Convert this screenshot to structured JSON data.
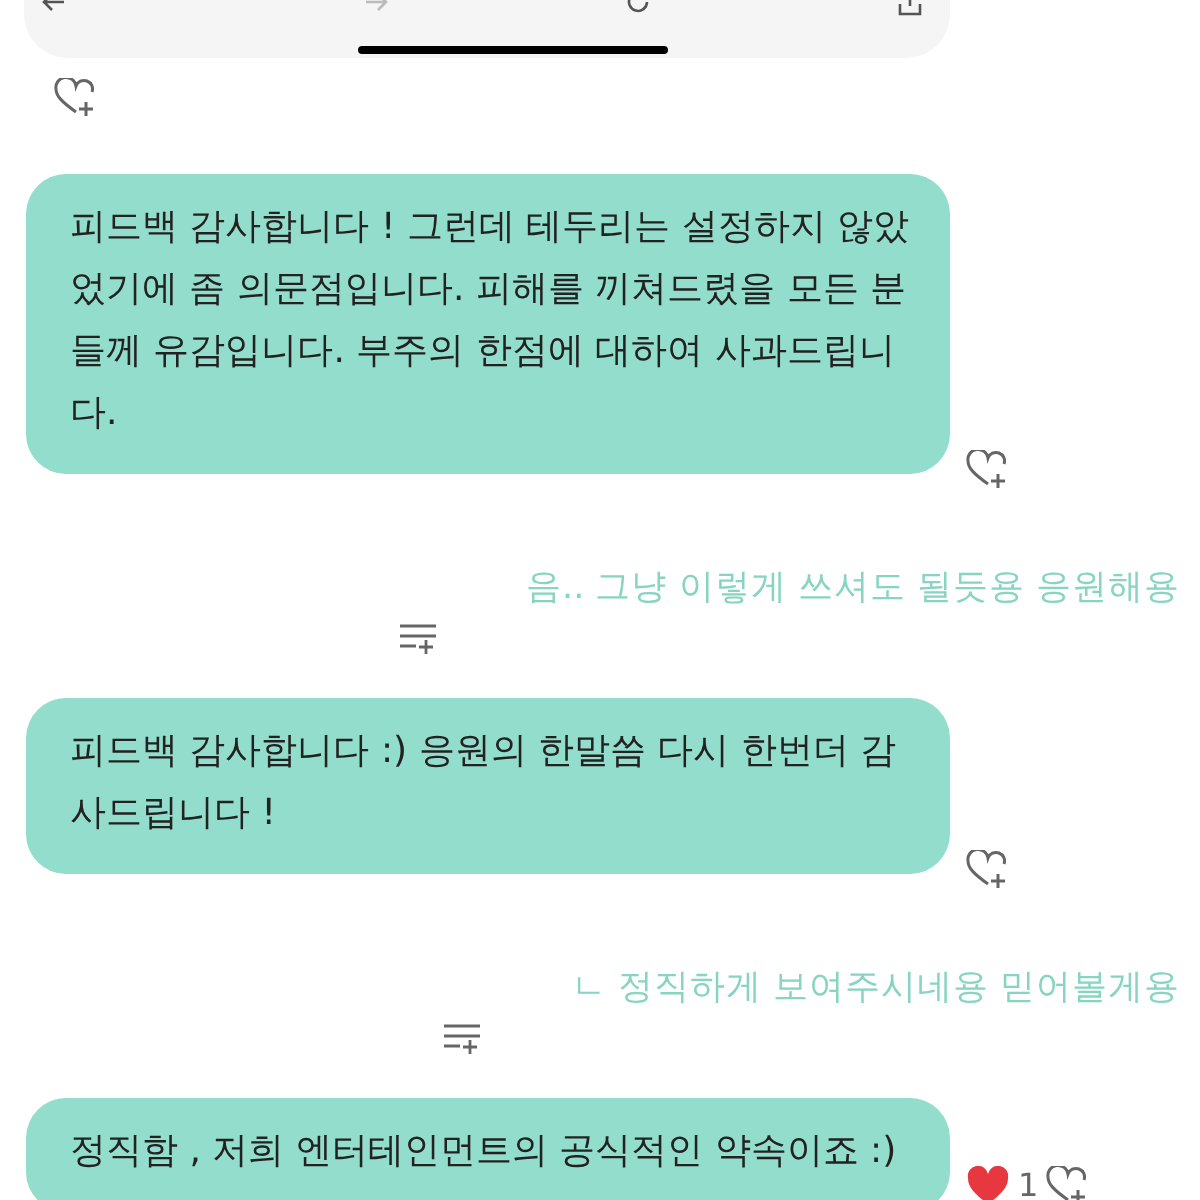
{
  "browser_toolbar": {
    "buttons": [
      {
        "kind": "back",
        "disabled": false
      },
      {
        "kind": "forward",
        "disabled": true
      },
      {
        "kind": "reload",
        "disabled": false
      },
      {
        "kind": "share",
        "disabled": false
      }
    ]
  },
  "messages": [
    {
      "kind": "reaction-only"
    },
    {
      "kind": "bubble",
      "text": "피드백 감사합니다 ! 그런데 테두리는 설정하지 않았었기에 좀 의문점입니다. 피해를 끼쳐드렸을 모든 분들께 유감입니다. 부주의 한점에 대하여 사과드립니다."
    },
    {
      "kind": "reply",
      "text": "음.. 그냥 이렇게 쓰셔도 될듯용 응원해용"
    },
    {
      "kind": "bubble",
      "text": "피드백 감사합니다 :) 응원의 한말씀 다시 한번더 감사드립니다 !"
    },
    {
      "kind": "reply",
      "text": "ㄴ 정직하게 보여주시네용 믿어볼게용"
    },
    {
      "kind": "bubble",
      "text": "정직함 , 저희 엔터테인먼트의 공식적인 약속이죠 :)",
      "likes": "1"
    }
  ]
}
